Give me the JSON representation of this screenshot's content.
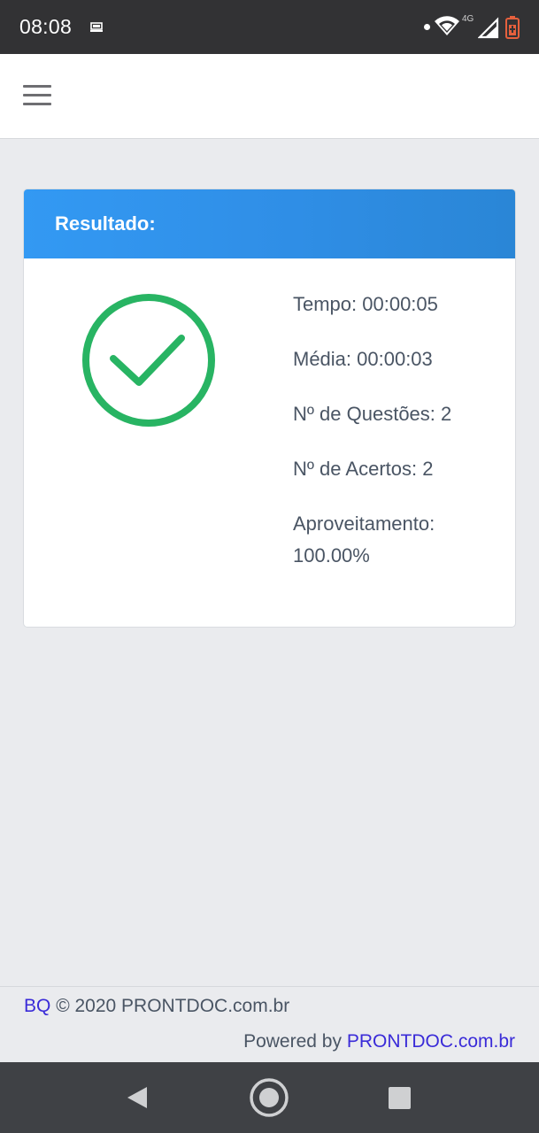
{
  "status_bar": {
    "time": "08:08",
    "network": "4G",
    "icons": [
      "notification-icon",
      "wifi-icon",
      "signal-icon",
      "battery-icon"
    ],
    "battery_color": "#e5603d"
  },
  "nav": {
    "menu_icon": "hamburger-menu-icon"
  },
  "result_card": {
    "title": "Resultado:",
    "header_color": "#3399f3",
    "success_icon": "check-circle-icon",
    "success_color": "#28b463",
    "stats": [
      "Tempo: 00:00:05",
      "Média: 00:00:03",
      "Nº de Questões: 2",
      "Nº de Acertos: 2"
    ],
    "aproveitamento_label": "Aproveitamento:",
    "aproveitamento_value": "100.00%"
  },
  "footer": {
    "brand_link": "BQ",
    "copyright": "© 2020 PRONTDOC.com.br",
    "powered_prefix": "Powered by",
    "powered_link": "PRONTDOC.com.br",
    "link_color": "#3a2bd8"
  },
  "android_nav": {
    "icons": [
      "back-icon",
      "home-icon",
      "recent-apps-icon"
    ]
  }
}
